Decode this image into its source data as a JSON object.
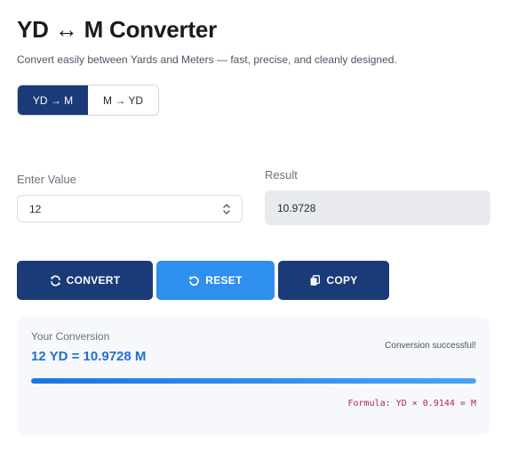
{
  "header": {
    "title": "YD ↔ M Converter",
    "subtitle": "Convert easily between Yards and Meters — fast, precise, and cleanly designed."
  },
  "toggle": {
    "yd_to_m_label": "YD → M",
    "m_to_yd_label": "M → YD",
    "active": "yd_to_m"
  },
  "input": {
    "label": "Enter Value",
    "value": "12"
  },
  "result": {
    "label": "Result",
    "value": "10.9728"
  },
  "buttons": {
    "convert_label": "CONVERT",
    "reset_label": "RESET",
    "copy_label": "COPY"
  },
  "conversion": {
    "heading": "Your Conversion",
    "summary": "12 YD = 10.9728 M",
    "status": "Conversion successful!",
    "progress_percent": 100,
    "formula": "Formula: YD × 0.9144 = M"
  },
  "colors": {
    "primary": "#1a3a78",
    "accent": "#2f8ff0",
    "highlight": "#1f6fd6",
    "formula": "#b0245a"
  },
  "icons": {
    "convert": "sync-icon",
    "reset": "undo-icon",
    "copy": "copy-icon",
    "stepper": "up-down-chevron-icon"
  }
}
